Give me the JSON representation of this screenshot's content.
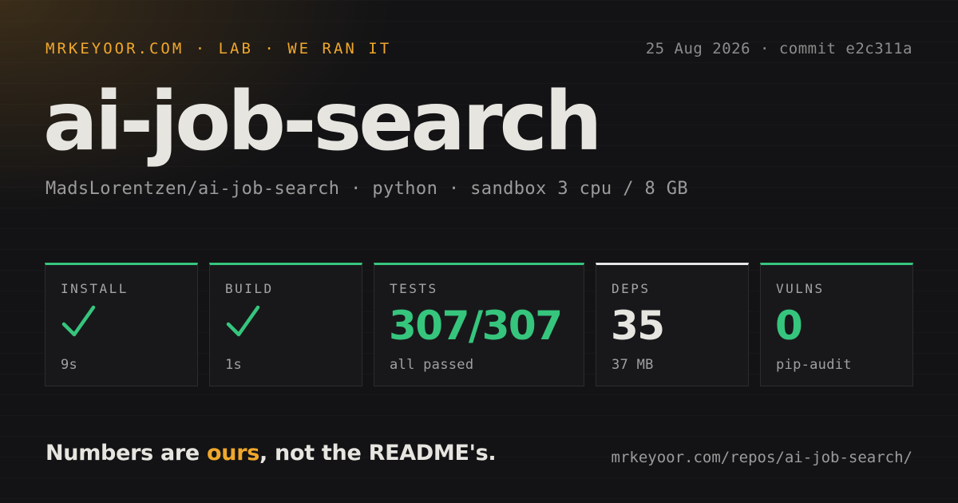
{
  "header": {
    "brand": "MRKEYOOR.COM · LAB · WE RAN IT",
    "meta": "25 Aug 2026 · commit e2c311a"
  },
  "title": "ai-job-search",
  "subtitle": "MadsLorentzen/ai-job-search · python · sandbox 3 cpu / 8 GB",
  "cards": [
    {
      "label": "INSTALL",
      "icon": "check-icon",
      "sub": "9s",
      "status": "pass"
    },
    {
      "label": "BUILD",
      "icon": "check-icon",
      "sub": "1s",
      "status": "pass"
    },
    {
      "label": "TESTS",
      "value": "307/307",
      "sub": "all passed",
      "status": "pass"
    },
    {
      "label": "DEPS",
      "value": "35",
      "sub": "37 MB",
      "status": "neutral"
    },
    {
      "label": "VULNS",
      "value": "0",
      "sub": "pip-audit",
      "status": "pass"
    }
  ],
  "footer": {
    "tagline_pre": "Numbers are ",
    "tagline_accent": "ours",
    "tagline_post": ", not the README's.",
    "url": "mrkeyoor.com/repos/ai-job-search/"
  },
  "colors": {
    "background": "#131315",
    "accent_orange": "#f0a72c",
    "pass_green": "#36c57d",
    "neutral_white": "#e6e6e6",
    "card_bg": "#18181b"
  }
}
